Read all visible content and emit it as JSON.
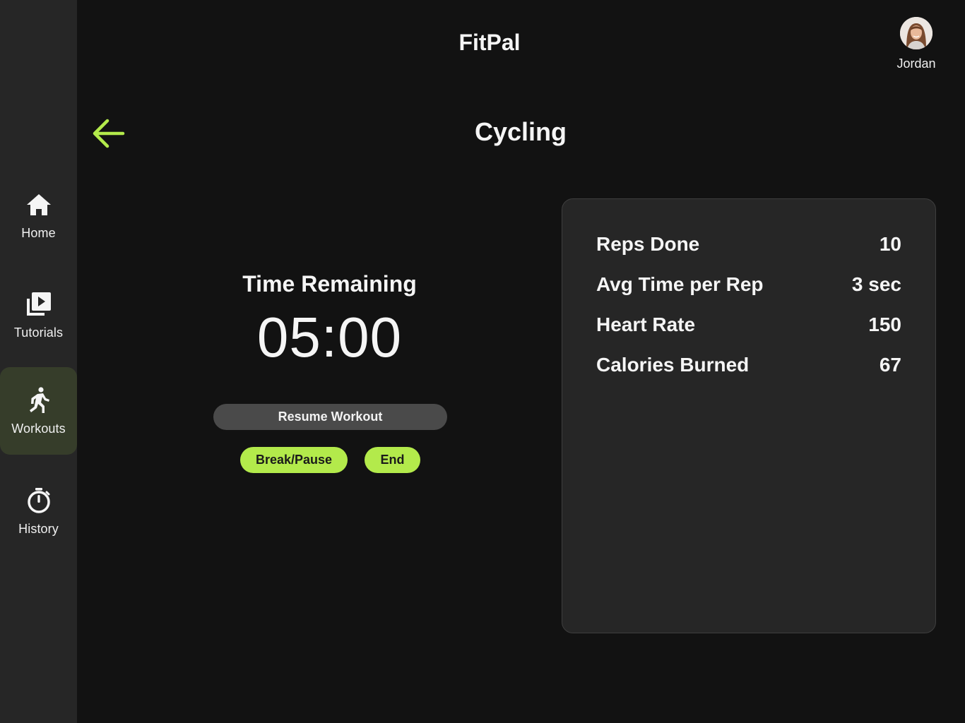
{
  "app": {
    "title": "FitPal"
  },
  "user": {
    "name": "Jordan"
  },
  "sidebar": {
    "items": [
      {
        "label": "Home",
        "icon": "home-icon"
      },
      {
        "label": "Tutorials",
        "icon": "video-library-icon"
      },
      {
        "label": "Workouts",
        "icon": "running-person-icon",
        "active": true
      },
      {
        "label": "History",
        "icon": "stopwatch-icon"
      }
    ]
  },
  "page": {
    "title": "Cycling",
    "back_icon": "arrow-left-icon"
  },
  "timer": {
    "label": "Time Remaining",
    "value": "05:00"
  },
  "controls": {
    "resume_label": "Resume Workout",
    "break_label": "Break/Pause",
    "end_label": "End"
  },
  "stats": [
    {
      "label": "Reps Done",
      "value": "10"
    },
    {
      "label": "Avg Time per Rep",
      "value": "3 sec"
    },
    {
      "label": "Heart Rate",
      "value": "150"
    },
    {
      "label": "Calories Burned",
      "value": "67"
    }
  ],
  "colors": {
    "accent": "#b3ea4b",
    "background": "#121212",
    "sidebar": "#262626",
    "active_nav": "#363d2a",
    "card": "#262626",
    "secondary_button": "#4a4a4a"
  }
}
